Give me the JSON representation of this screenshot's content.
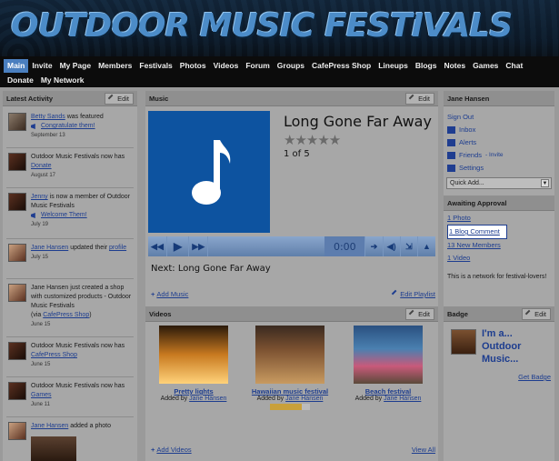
{
  "site": {
    "title": "OUTDOOR MUSIC FESTIVALS"
  },
  "nav": {
    "row1": [
      "Main",
      "Invite",
      "My Page",
      "Members",
      "Festivals",
      "Photos",
      "Videos",
      "Forum",
      "Groups",
      "CafePress Shop",
      "Lineups",
      "Blogs",
      "Notes",
      "Games",
      "Chat"
    ],
    "row2": [
      "Donate",
      "My Network"
    ],
    "active": "Main"
  },
  "latest_activity": {
    "title": "Latest Activity",
    "edit_label": "Edit",
    "items": [
      {
        "pre": "",
        "link": "Betty Sands",
        "post": " was featured",
        "sub_link": "Congratulate them!",
        "date": "September 13"
      },
      {
        "pre": "Outdoor Music Festivals now has ",
        "link": "Donate",
        "post": "",
        "date": "August 17"
      },
      {
        "pre": "",
        "link": "Jenny",
        "post": " is now a member of Outdoor Music Festivals",
        "sub_link": "Welcome Them!",
        "date": "July 19"
      },
      {
        "pre": "",
        "link": "Jane Hansen",
        "post": " updated their ",
        "link2": "profile",
        "date": "July 15"
      },
      {
        "pre": "Jane Hansen just created a shop with customized products - Outdoor Music Festivals",
        "paren_pre": "(via ",
        "paren_link": "CafePress Shop",
        "paren_post": ")",
        "date": "June 15"
      },
      {
        "pre": "Outdoor Music Festivals now has ",
        "link": "CafePress Shop",
        "post": "",
        "date": "June 15"
      },
      {
        "pre": "Outdoor Music Festivals now has ",
        "link": "Games",
        "post": "",
        "date": "June 11"
      },
      {
        "pre": "",
        "link": "Jane Hansen",
        "post": " added a photo",
        "date": ""
      }
    ]
  },
  "music": {
    "title": "Music",
    "edit_label": "Edit",
    "song_title": "Long Gone Far Away",
    "stars": "★★★★★",
    "track_count": "1 of 5",
    "time": "0:00",
    "next": "Next: Long Gone Far Away",
    "add_music": "Add Music",
    "edit_playlist": "Edit Playlist"
  },
  "videos": {
    "title": "Videos",
    "edit_label": "Edit",
    "items": [
      {
        "title": "Pretty lights",
        "by_pre": "Added by ",
        "by": "Jane Hansen",
        "rating": false
      },
      {
        "title": "Hawaiian music festival",
        "by_pre": "Added by ",
        "by": "Jane Hansen",
        "rating": true,
        "rating_value": 0.8
      },
      {
        "title": "Beach festival",
        "by_pre": "Added by ",
        "by": "Jane Hansen",
        "rating": false
      }
    ],
    "add_videos": "Add Videos",
    "view_all": "View All"
  },
  "user_box": {
    "name": "Jane Hansen",
    "sign_out": "Sign Out",
    "links": [
      {
        "label": "Inbox",
        "icon": "inbox-icon"
      },
      {
        "label": "Alerts",
        "icon": "alerts-icon"
      },
      {
        "label": "Friends",
        "suffix": " - Invite",
        "icon": "friends-icon"
      },
      {
        "label": "Settings",
        "icon": "settings-icon"
      }
    ],
    "quick_add": "Quick Add..."
  },
  "awaiting": {
    "title": "Awaiting Approval",
    "items": [
      "1 Photo",
      "1 Blog Comment",
      "13 New Members",
      "1 Video"
    ],
    "network_text": "This is a network for festival-lovers!"
  },
  "badge": {
    "title": "Badge",
    "edit_label": "Edit",
    "line1": "I'm a...",
    "line2": "Outdoor",
    "line3": "Music...",
    "get_badge": "Get Badge"
  },
  "colors": {
    "accent": "#4a7fbf",
    "link": "#1d3d8f",
    "player": "#0d53a0"
  }
}
